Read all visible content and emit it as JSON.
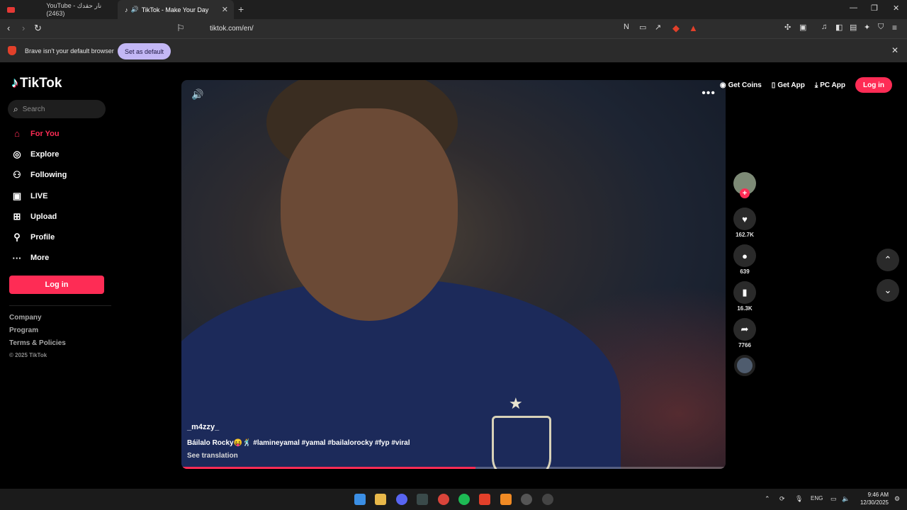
{
  "browser": {
    "tabs": [
      {
        "title": "YouTube - نار حقدك (2463)",
        "active": false
      },
      {
        "title": "TikTok - Make Your Day",
        "active": true
      }
    ],
    "url": "tiktok.com/en/",
    "infobar": {
      "message": "Brave isn't your default browser",
      "button": "Set as default"
    }
  },
  "tiktok": {
    "logo": "TikTok",
    "search_placeholder": "Search",
    "nav": [
      {
        "label": "For You",
        "icon": "home-icon",
        "active": true
      },
      {
        "label": "Explore",
        "icon": "compass-icon",
        "active": false
      },
      {
        "label": "Following",
        "icon": "person-icon",
        "active": false
      },
      {
        "label": "LIVE",
        "icon": "live-icon",
        "active": false
      },
      {
        "label": "Upload",
        "icon": "upload-icon",
        "active": false
      },
      {
        "label": "Profile",
        "icon": "profile-icon",
        "active": false
      },
      {
        "label": "More",
        "icon": "more-icon",
        "active": false
      }
    ],
    "login_label": "Log in",
    "footer": [
      "Company",
      "Program",
      "Terms & Policies"
    ],
    "copyright": "© 2025 TikTok",
    "topbar": {
      "get_coins": "Get Coins",
      "get_app": "Get App",
      "pc_app": "PC App",
      "login": "Log in"
    },
    "video": {
      "author": "_m4zzy_",
      "caption": "Báilalo Rocky😝🕺 #lamineyamal #yamal #bailalorocky #fyp #viral",
      "see_translation": "See translation",
      "progress": 0.54
    },
    "actions": {
      "likes": "162.7K",
      "comments": "639",
      "saves": "16.3K",
      "shares": "7766"
    }
  },
  "taskbar": {
    "lang": "ENG",
    "time": "9:46 AM",
    "date": "12/30/2025"
  }
}
